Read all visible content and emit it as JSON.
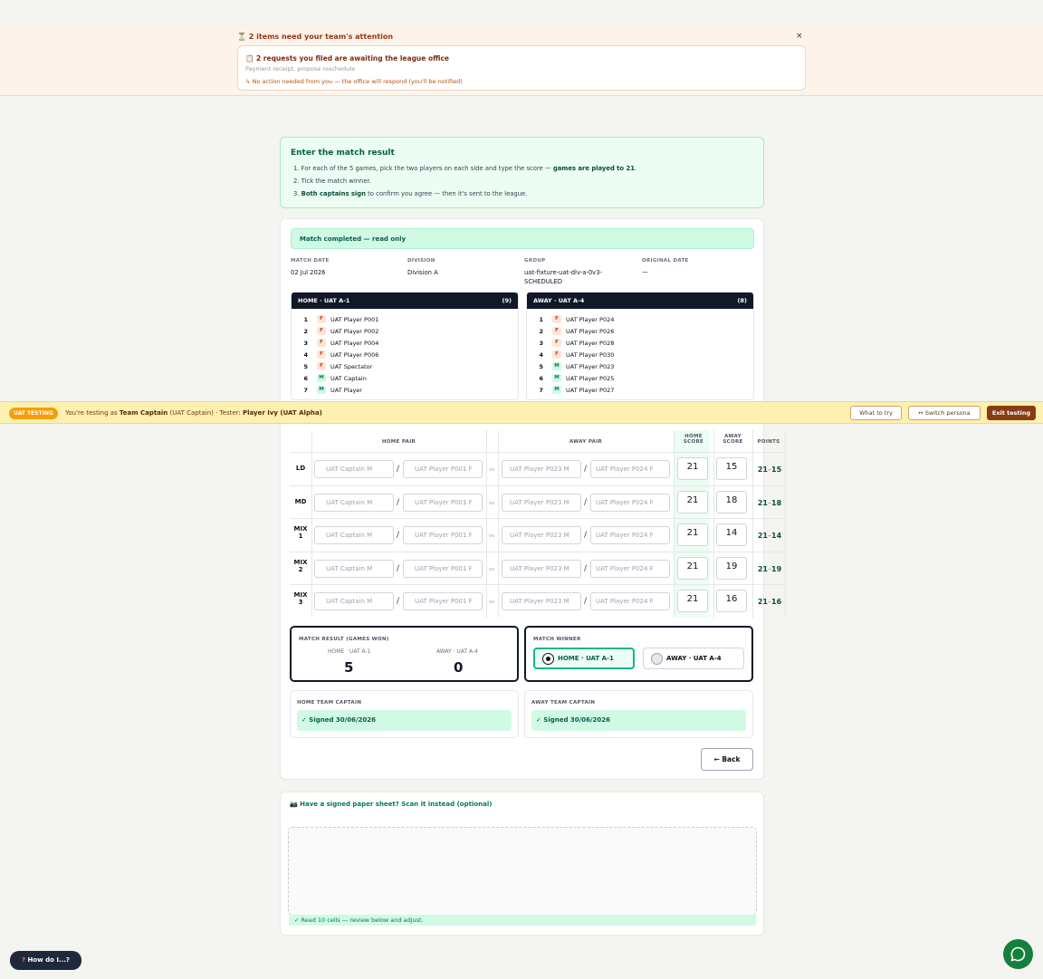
{
  "attention": {
    "heading": "⏳ 2 items need your team's attention",
    "close": "×",
    "card_title": "📋 2 requests you filed are awaiting the league office",
    "card_sub": "Payment receipt, propose reschedule",
    "card_note": "↳ No action needed from you — the office will respond (you'll be notified)"
  },
  "instructions": {
    "title": "Enter the match result",
    "step1_a": "1. For each of the 5 games, pick the two players on each side and type the score — ",
    "step1_b": "games are played to 21",
    "step1_c": ".",
    "step2": "2. Tick the match winner.",
    "step3_a": "3. ",
    "step3_b": "Both captains sign",
    "step3_c": " to confirm you agree — then it's sent to the league."
  },
  "status": "Match completed — read only",
  "meta": {
    "match_date_label": "MATCH DATE",
    "match_date": "02 Jul 2026",
    "division_label": "DIVISION",
    "division": "Division A",
    "group_label": "GROUP",
    "group_line1": "uat-fixture-uat-div-a-0v3-",
    "group_line2": "SCHEDULED",
    "original_date_label": "ORIGINAL DATE",
    "original_date": "—"
  },
  "home_roster": {
    "title": "HOME · UAT A-1",
    "count": "(9)",
    "players": [
      {
        "n": "1",
        "s": "F",
        "name": "UAT Player P001"
      },
      {
        "n": "2",
        "s": "F",
        "name": "UAT Player P002"
      },
      {
        "n": "3",
        "s": "F",
        "name": "UAT Player P004"
      },
      {
        "n": "4",
        "s": "F",
        "name": "UAT Player P006"
      },
      {
        "n": "5",
        "s": "F",
        "name": "UAT Spectator"
      },
      {
        "n": "6",
        "s": "M",
        "name": "UAT Captain"
      },
      {
        "n": "7",
        "s": "M",
        "name": "UAT Player"
      }
    ]
  },
  "away_roster": {
    "title": "AWAY · UAT A-4",
    "count": "(8)",
    "players": [
      {
        "n": "1",
        "s": "F",
        "name": "UAT Player P024"
      },
      {
        "n": "2",
        "s": "F",
        "name": "UAT Player P026"
      },
      {
        "n": "3",
        "s": "F",
        "name": "UAT Player P028"
      },
      {
        "n": "4",
        "s": "F",
        "name": "UAT Player P030"
      },
      {
        "n": "5",
        "s": "M",
        "name": "UAT Player P023"
      },
      {
        "n": "6",
        "s": "M",
        "name": "UAT Player P025"
      },
      {
        "n": "7",
        "s": "M",
        "name": "UAT Player P027"
      }
    ]
  },
  "uat_bar": {
    "badge": "UAT TESTING",
    "text_a": "You're testing as ",
    "role": "Team Captain",
    "text_b": " (UAT Captain)   · Tester: ",
    "tester": "Player Ivy (UAT Alpha)",
    "what_to_try": "What to try",
    "switch": "↔ Switch persona",
    "exit": "Exit testing"
  },
  "games": {
    "headers": {
      "home_pair": "HOME PAIR",
      "away_pair": "AWAY PAIR",
      "home_score_1": "HOME",
      "home_score_2": "SCORE",
      "away_score_1": "AWAY",
      "away_score_2": "SCORE",
      "points": "POINTS"
    },
    "vs": "vs",
    "slash": "/",
    "rows": [
      {
        "l1": "LD",
        "l2": "",
        "h1": "UAT Captain M",
        "h2": "UAT Player P001 F",
        "a1": "UAT Player P023 M",
        "a2": "UAT Player P024 F",
        "hs": "21",
        "as": "15",
        "ph": "21",
        "pa": "15"
      },
      {
        "l1": "MD",
        "l2": "",
        "h1": "UAT Captain M",
        "h2": "UAT Player P001 F",
        "a1": "UAT Player P023 M",
        "a2": "UAT Player P024 F",
        "hs": "21",
        "as": "18",
        "ph": "21",
        "pa": "18"
      },
      {
        "l1": "MIX",
        "l2": "1",
        "h1": "UAT Captain M",
        "h2": "UAT Player P001 F",
        "a1": "UAT Player P023 M",
        "a2": "UAT Player P024 F",
        "hs": "21",
        "as": "14",
        "ph": "21",
        "pa": "14"
      },
      {
        "l1": "MIX",
        "l2": "2",
        "h1": "UAT Captain M",
        "h2": "UAT Player P001 F",
        "a1": "UAT Player P023 M",
        "a2": "UAT Player P024 F",
        "hs": "21",
        "as": "19",
        "ph": "21",
        "pa": "19"
      },
      {
        "l1": "MIX",
        "l2": "3",
        "h1": "UAT Captain M",
        "h2": "UAT Player P001 F",
        "a1": "UAT Player P023 M",
        "a2": "UAT Player P024 F",
        "hs": "21",
        "as": "16",
        "ph": "21",
        "pa": "16"
      }
    ],
    "dash": "–"
  },
  "result": {
    "label": "MATCH RESULT (GAMES WON)",
    "home_team": "HOME · UAT A-1",
    "away_team": "AWAY · UAT A-4",
    "home_won": "5",
    "away_won": "0"
  },
  "winner": {
    "label": "MATCH WINNER",
    "home": "HOME · UAT A-1",
    "away": "AWAY · UAT A-4",
    "selected": "home"
  },
  "signatures": {
    "home_label": "HOME TEAM CAPTAIN",
    "home_value": "✓ Signed 30/06/2026",
    "away_label": "AWAY TEAM CAPTAIN",
    "away_value": "✓ Signed 30/06/2026"
  },
  "back": "← Back",
  "scan": {
    "title": "📷 Have a signed paper sheet? Scan it instead (optional)",
    "ok": "✓ Read 10 cells — review below and adjust."
  },
  "help": {
    "q": "?",
    "label": " How do I...?"
  },
  "colors": {
    "accent": "#10b981",
    "brand_green": "#15803d",
    "dark": "#111827",
    "uat_bg": "#fdf0b0"
  }
}
